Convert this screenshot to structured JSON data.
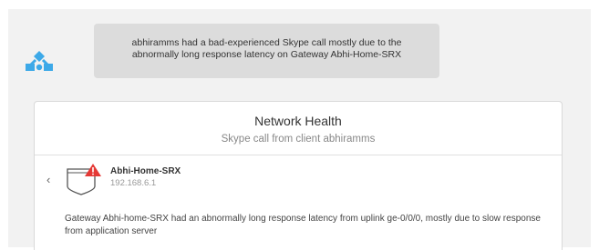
{
  "assistant": {
    "avatar_icon": "network-topology-icon",
    "accent_color": "#3da9e8",
    "message": "abhiramms had a bad-experienced Skype call mostly due to the abnormally long response latency on Gateway Abhi-Home-SRX"
  },
  "network_health": {
    "title": "Network Health",
    "subtitle": "Skype call from client abhiramms",
    "back_icon": "chevron-left-icon",
    "back_glyph": "‹",
    "device": {
      "icon": "gateway-icon",
      "alert_icon": "warning-icon",
      "alert_color": "#e53935",
      "name": "Abhi-Home-SRX",
      "ip": "192.168.6.1"
    },
    "message": "Gateway Abhi-home-SRX had an abnormally long response latency from uplink ge-0/0/0, mostly due to slow response from application server"
  }
}
